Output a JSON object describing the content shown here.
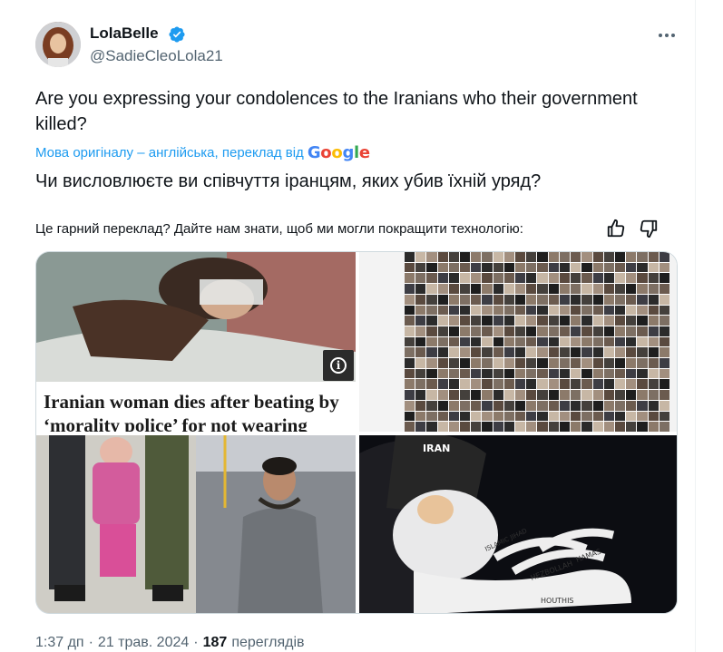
{
  "author": {
    "display_name": "LolaBelle",
    "handle": "@SadieCleoLola21",
    "verified_icon": "verified-badge-icon",
    "verified_color": "#1d9bf0"
  },
  "tweet": {
    "text": "Are you expressing your condolences to the Iranians who their government killed?",
    "translation_label": "Мова оригіналу – англійська, переклад від",
    "translation_provider": "Google",
    "translated_text": "Чи висловлюєте ви співчуття іранцям, яких убив їхній уряд?",
    "feedback_prompt": "Це гарний переклад? Дайте нам знати, щоб ми могли покращити технологію:"
  },
  "media": {
    "headline_image_text": "Iranian woman dies after beating by ‘morality police’ for not wearing",
    "cartoon_labels": [
      "IRAN",
      "HEZBOLLAH",
      "HAMAS",
      "HOUTHIS",
      "ISLAMIC JIHAD"
    ]
  },
  "meta": {
    "time": "1:37 дп",
    "separator": "·",
    "date": "21 трав. 2024",
    "views_count": "187",
    "views_label": "переглядів"
  },
  "colors": {
    "accent": "#1d9bf0",
    "secondary_text": "#536471",
    "primary_text": "#0f1419"
  }
}
